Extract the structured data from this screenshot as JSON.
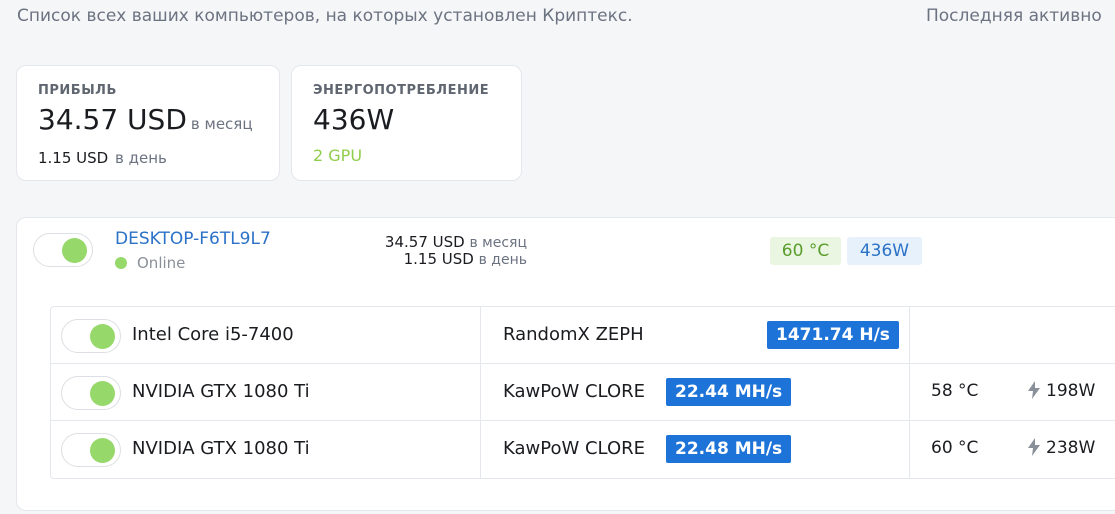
{
  "header": {
    "subtitle": "Список всех ваших компьютеров, на которых установлен Криптекс.",
    "last_active_label": "Последняя активно"
  },
  "summary": {
    "profit": {
      "label": "ПРИБЫЛЬ",
      "monthly_value": "34.57 USD",
      "monthly_unit": "в месяц",
      "daily_value": "1.15 USD",
      "daily_unit": "в день"
    },
    "power": {
      "label": "ЭНЕРГОПОТРЕБЛЕНИЕ",
      "value": "436W",
      "gpu_count": "2 GPU"
    }
  },
  "rig": {
    "name": "DESKTOP-F6TL9L7",
    "status": "Online",
    "enabled": true,
    "monthly_value": "34.57 USD",
    "monthly_unit": "в месяц",
    "daily_value": "1.15 USD",
    "daily_unit": "в день",
    "temperature": "60 °C",
    "power": "436W",
    "devices": [
      {
        "name": "Intel Core i5-7400",
        "enabled": true,
        "algorithm": "RandomX ZEPH",
        "hashrate": "1471.74 H/s",
        "temperature": "",
        "power": ""
      },
      {
        "name": "NVIDIA GTX 1080 Ti",
        "enabled": true,
        "algorithm": "KawPoW CLORE",
        "hashrate": "22.44 MH/s",
        "temperature": "58 °C",
        "power": "198W"
      },
      {
        "name": "NVIDIA GTX 1080 Ti",
        "enabled": true,
        "algorithm": "KawPoW CLORE",
        "hashrate": "22.48 MH/s",
        "temperature": "60 °C",
        "power": "238W"
      }
    ]
  },
  "colors": {
    "accent_blue": "#1e73d8",
    "link_blue": "#2b72c7",
    "online_green": "#96d86a",
    "gpu_green": "#8fce4c"
  }
}
